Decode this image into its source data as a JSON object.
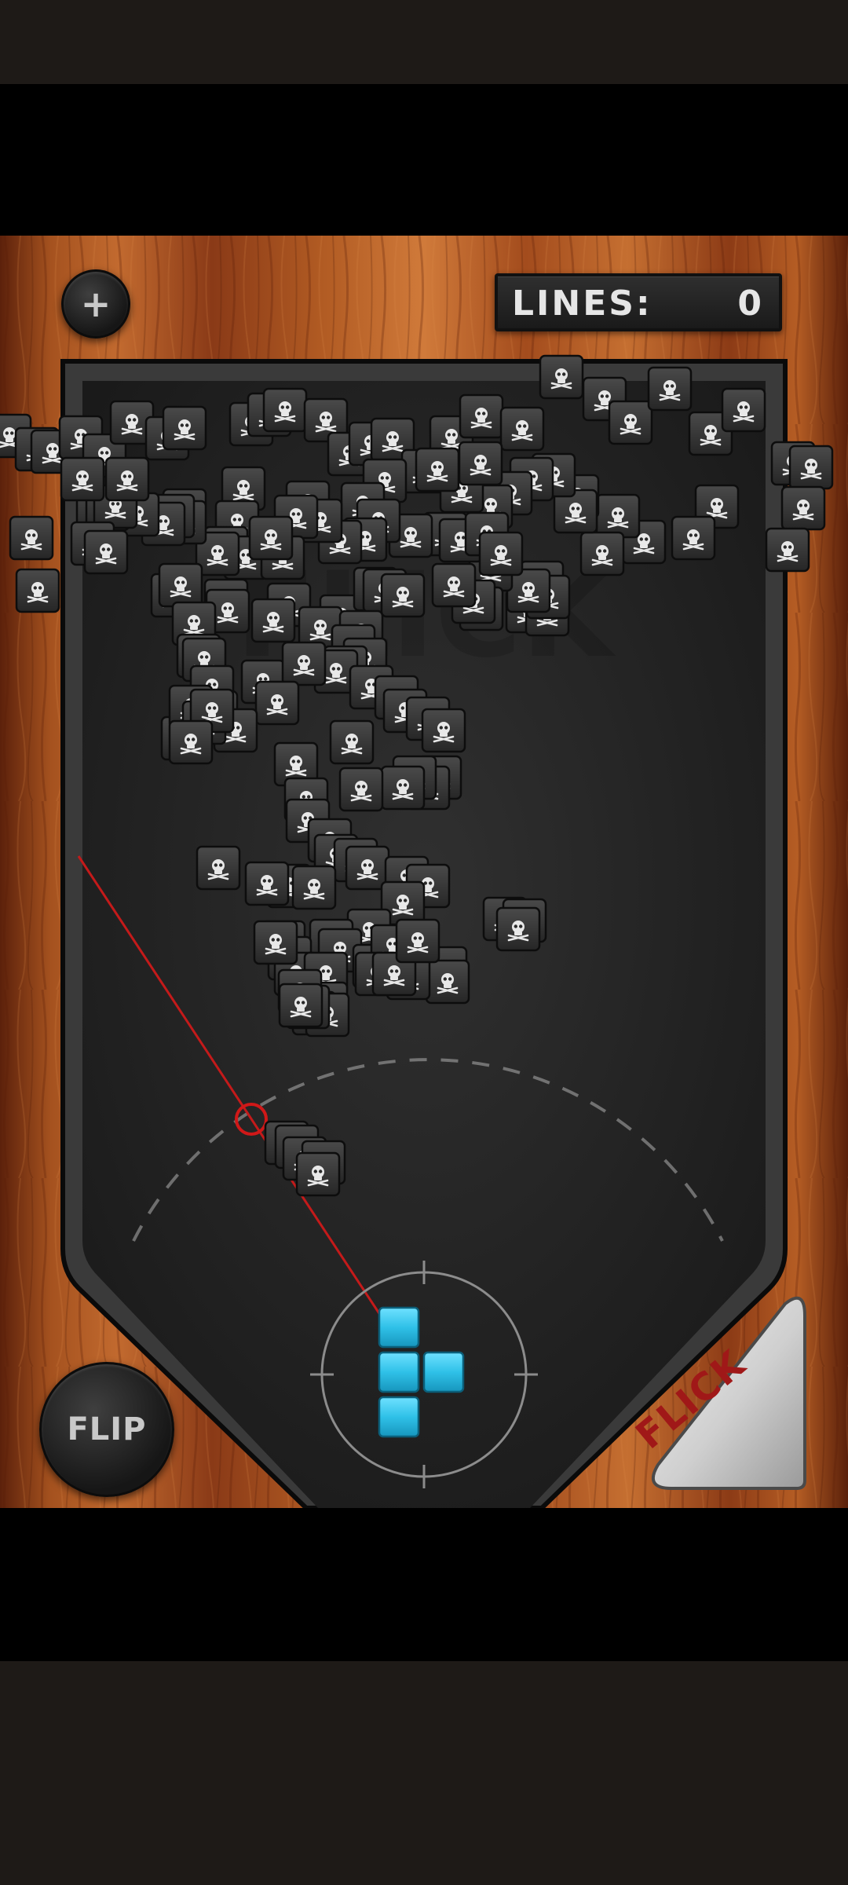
{
  "hud": {
    "add_button": "+",
    "lines_label": "LINES:",
    "lines_value": "0",
    "flip_button": "FLIP",
    "flick_button": "FLICK"
  },
  "playfield": {
    "watermark": "FLICK"
  },
  "current_piece": {
    "type": "T-tetromino",
    "color": "#2fc1e8",
    "cells": [
      [
        0,
        0
      ],
      [
        0,
        1
      ],
      [
        1,
        1
      ],
      [
        0,
        2
      ]
    ]
  },
  "colors": {
    "wood": "#8a3a17",
    "board": "#252525",
    "aim_line": "#c41a1a",
    "piece": "#2fc1e8"
  },
  "skull_block_count": 110
}
